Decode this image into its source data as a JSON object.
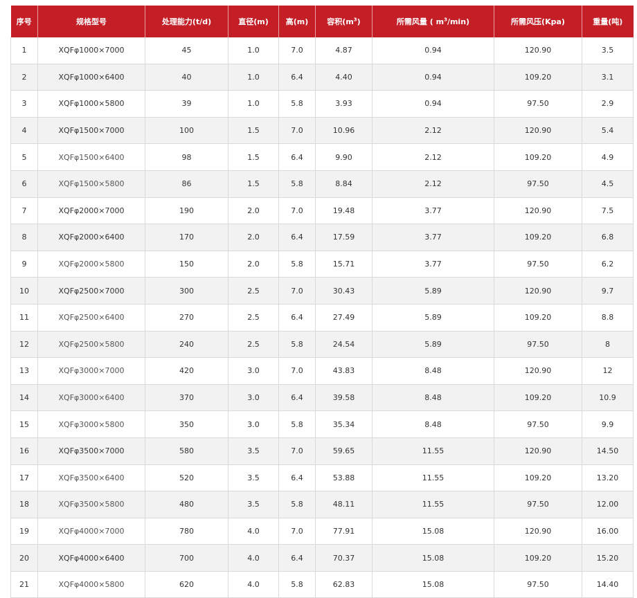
{
  "table": {
    "headers": {
      "no": "序号",
      "model": "规格型号",
      "capacity": "处理能力(t/d)",
      "diameter": "直径(m)",
      "height": "高(m)",
      "volume_pre": "容积(m",
      "volume_sup": "3",
      "volume_post": ")",
      "airflow_pre": "所需风量 ( m",
      "airflow_sup": "3",
      "airflow_post": "/min)",
      "pressure": "所需风压(Kpa)",
      "weight": "重量(吨)"
    },
    "rows": [
      [
        "1",
        "XQFφ1000×7000",
        "45",
        "1.0",
        "7.0",
        "4.87",
        "0.94",
        "120.90",
        "3.5"
      ],
      [
        "2",
        "XQFφ1000×6400",
        "40",
        "1.0",
        "6.4",
        "4.40",
        "0.94",
        "109.20",
        "3.1"
      ],
      [
        "3",
        "XQFφ1000×5800",
        "39",
        "1.0",
        "5.8",
        "3.93",
        "0.94",
        "97.50",
        "2.9"
      ],
      [
        "4",
        "XQFφ1500×7000",
        "100",
        "1.5",
        "7.0",
        "10.96",
        "2.12",
        "120.90",
        "5.4"
      ],
      [
        "5",
        "XQFφ1500×6400",
        "98",
        "1.5",
        "6.4",
        "9.90",
        "2.12",
        "109.20",
        "4.9"
      ],
      [
        "6",
        "XQFφ1500×5800",
        "86",
        "1.5",
        "5.8",
        "8.84",
        "2.12",
        "97.50",
        "4.5"
      ],
      [
        "7",
        "XQFφ2000×7000",
        "190",
        "2.0",
        "7.0",
        "19.48",
        "3.77",
        "120.90",
        "7.5"
      ],
      [
        "8",
        "XQFφ2000×6400",
        "170",
        "2.0",
        "6.4",
        "17.59",
        "3.77",
        "109.20",
        "6.8"
      ],
      [
        "9",
        "XQFφ2000×5800",
        "150",
        "2.0",
        "5.8",
        "15.71",
        "3.77",
        "97.50",
        "6.2"
      ],
      [
        "10",
        "XQFφ2500×7000",
        "300",
        "2.5",
        "7.0",
        "30.43",
        "5.89",
        "120.90",
        "9.7"
      ],
      [
        "11",
        "XQFφ2500×6400",
        "270",
        "2.5",
        "6.4",
        "27.49",
        "5.89",
        "109.20",
        "8.8"
      ],
      [
        "12",
        "XQFφ2500×5800",
        "240",
        "2.5",
        "5.8",
        "24.54",
        "5.89",
        "97.50",
        "8"
      ],
      [
        "13",
        "XQFφ3000×7000",
        "420",
        "3.0",
        "7.0",
        "43.83",
        "8.48",
        "120.90",
        "12"
      ],
      [
        "14",
        "XQFφ3000×6400",
        "370",
        "3.0",
        "6.4",
        "39.58",
        "8.48",
        "109.20",
        "10.9"
      ],
      [
        "15",
        "XQFφ3000×5800",
        "350",
        "3.0",
        "5.8",
        "35.34",
        "8.48",
        "97.50",
        "9.9"
      ],
      [
        "16",
        "XQFφ3500×7000",
        "580",
        "3.5",
        "7.0",
        "59.65",
        "11.55",
        "120.90",
        "14.50"
      ],
      [
        "17",
        "XQFφ3500×6400",
        "520",
        "3.5",
        "6.4",
        "53.88",
        "11.55",
        "109.20",
        "13.20"
      ],
      [
        "18",
        "XQFφ3500×5800",
        "480",
        "3.5",
        "5.8",
        "48.11",
        "11.55",
        "97.50",
        "12.00"
      ],
      [
        "19",
        "XQFφ4000×7000",
        "780",
        "4.0",
        "7.0",
        "77.91",
        "15.08",
        "120.90",
        "16.00"
      ],
      [
        "20",
        "XQFφ4000×6400",
        "700",
        "4.0",
        "6.4",
        "70.37",
        "15.08",
        "109.20",
        "15.20"
      ],
      [
        "21",
        "XQFφ4000×5800",
        "620",
        "4.0",
        "5.8",
        "62.83",
        "15.08",
        "97.50",
        "14.40"
      ]
    ]
  },
  "colors": {
    "header_bg": "#c41e27",
    "header_text": "#ffffff",
    "row_alt_bg": "#f2f2f2",
    "border": "#d9d9d9"
  }
}
